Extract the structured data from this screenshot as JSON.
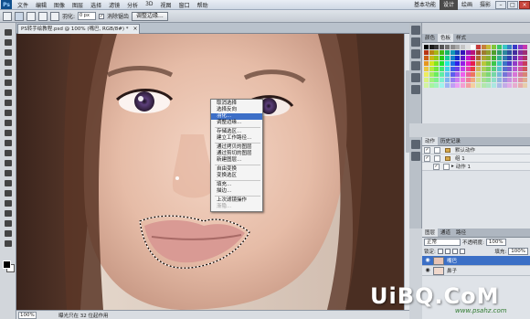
{
  "menubar": {
    "logo": "Ps",
    "items": [
      "文件",
      "编辑",
      "图像",
      "图层",
      "选择",
      "滤镜",
      "分析",
      "3D",
      "视图",
      "窗口",
      "帮助"
    ],
    "workspaces": [
      "基本功能",
      "设计",
      "绘画",
      "摄影"
    ],
    "active_workspace": "设计",
    "window_buttons": [
      "–",
      "□",
      "×"
    ]
  },
  "options": {
    "feather_label": "羽化:",
    "feather_value": "0 px",
    "antialias_label": "消除锯齿",
    "antialias_checked": "✓",
    "refine_button": "调整边缘..."
  },
  "document": {
    "tab_title": "PS转手绘教程.psd @ 100% (嘴巴, RGB/8#) *",
    "tab_close": "×"
  },
  "context_menu": {
    "items": [
      {
        "label": "取消选择",
        "state": "normal"
      },
      {
        "label": "选择反向",
        "state": "normal"
      },
      {
        "label": "羽化...",
        "state": "highlight"
      },
      {
        "label": "调整边缘...",
        "state": "normal"
      },
      {
        "sep": true
      },
      {
        "label": "存储选区...",
        "state": "normal"
      },
      {
        "label": "建立工作路径...",
        "state": "normal"
      },
      {
        "sep": true
      },
      {
        "label": "通过拷贝的图层",
        "state": "normal"
      },
      {
        "label": "通过剪切的图层",
        "state": "normal"
      },
      {
        "label": "新建图层...",
        "state": "normal"
      },
      {
        "sep": true
      },
      {
        "label": "自由变换",
        "state": "normal"
      },
      {
        "label": "变换选区",
        "state": "normal"
      },
      {
        "sep": true
      },
      {
        "label": "填充...",
        "state": "normal"
      },
      {
        "label": "描边...",
        "state": "normal"
      },
      {
        "sep": true
      },
      {
        "label": "上次滤镜操作",
        "state": "normal"
      },
      {
        "label": "渐隐...",
        "state": "disabled"
      }
    ]
  },
  "status": {
    "zoom": "100%",
    "info": "曝光只在 32 位起作用"
  },
  "panels": {
    "swatch_tabs": [
      "颜色",
      "色板",
      "样式"
    ],
    "swatch_active": "色板",
    "action_tabs": [
      "动作",
      "历史记录"
    ],
    "actions": [
      {
        "label": "默认动作",
        "checked": "✓",
        "folder": true
      },
      {
        "label": "组 1",
        "checked": "✓",
        "folder": true
      },
      {
        "label": "动作 1",
        "checked": "✓",
        "folder": false
      }
    ],
    "layer_tabs": [
      "图层",
      "通道",
      "路径"
    ],
    "blend_mode": "正常",
    "opacity_label": "不透明度:",
    "opacity_value": "100%",
    "lock_label": "锁定:",
    "fill_label": "填充:",
    "fill_value": "100%",
    "layers": [
      {
        "label": "嘴巴",
        "selected": true
      },
      {
        "label": "鼻子",
        "selected": false
      }
    ]
  },
  "watermark": {
    "main": "UiBQ.CoM",
    "sub": "www.psahz.com"
  }
}
